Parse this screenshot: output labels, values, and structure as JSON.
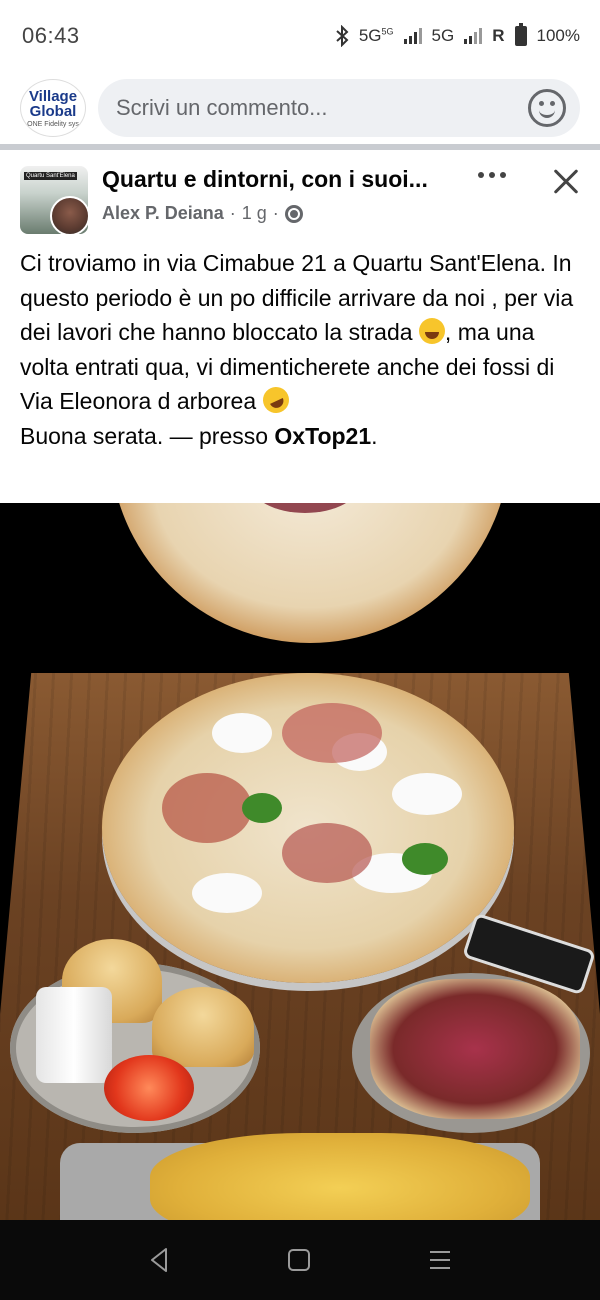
{
  "status_bar": {
    "time": "06:43",
    "network1": "5G",
    "network1_sup": "5G",
    "network2": "5G",
    "roaming": "R",
    "battery": "100%"
  },
  "comment_bar": {
    "page_avatar_line1": "Village",
    "page_avatar_line2": "Global",
    "page_avatar_line3": "ONE Fidelity sys",
    "placeholder": "Scrivi un commento..."
  },
  "post": {
    "group_name": "Quartu e dintorni, con i suoi...",
    "group_avatar_tag": "Quartu Sant'Elena",
    "author": "Alex P. Deiana",
    "time": "1 g",
    "text_line1": "Ci troviamo in via Cimabue 21 a Quartu Sant'Elena. In questo periodo è un po difficile arrivare da noi , per via dei lavori che hanno bloccato la strada ",
    "text_line2": ", ma una volta entrati qua, vi dimenticherete anche dei fossi di Via Eleonora d arborea ",
    "text_line3_a": "Buona serata. — presso ",
    "place": "OxTop21",
    "text_line3_end": "."
  },
  "icons": {
    "emoji_sweat": "grinning-sweat-icon",
    "emoji_rofl": "rofl-icon",
    "more": "more-icon",
    "close": "close-icon",
    "globe": "globe-icon",
    "emoji_picker": "emoji-icon"
  },
  "colors": {
    "divider": "#c9ccd1",
    "secondary_text": "#65676b",
    "input_bg": "#eef0f3",
    "nav_bar": "#0a0a0a"
  }
}
